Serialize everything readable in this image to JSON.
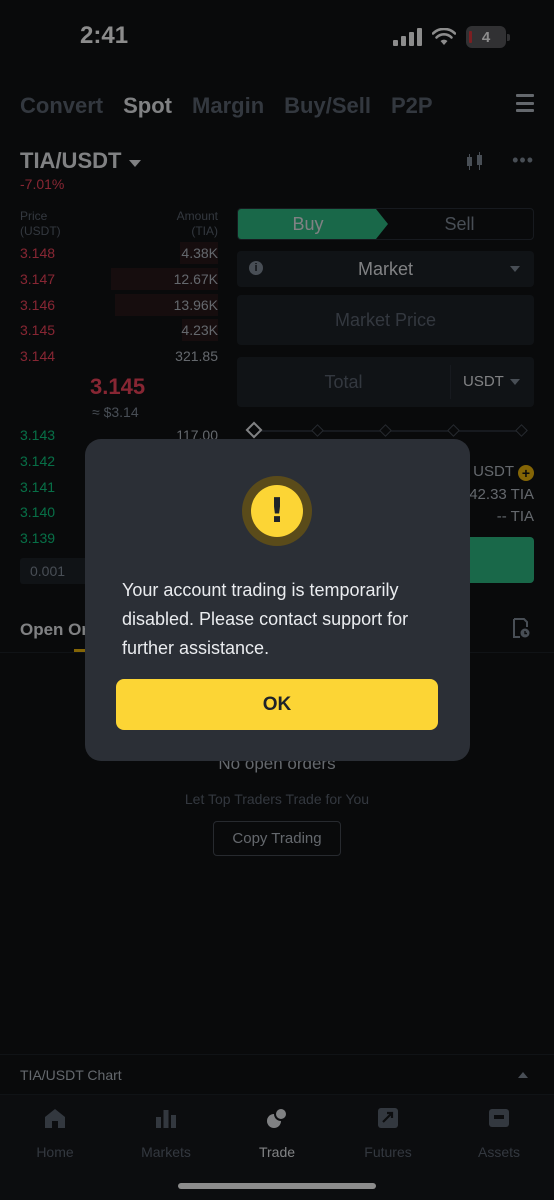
{
  "status": {
    "time": "2:41",
    "battery": "4"
  },
  "top_tabs": [
    {
      "label": "Convert",
      "active": false
    },
    {
      "label": "Spot",
      "active": true
    },
    {
      "label": "Margin",
      "active": false
    },
    {
      "label": "Buy/Sell",
      "active": false
    },
    {
      "label": "P2P",
      "active": false
    }
  ],
  "pair": {
    "name": "TIA/USDT",
    "change": "-7.01%"
  },
  "order_book": {
    "price_label": "Price",
    "price_unit": "(USDT)",
    "amount_label": "Amount",
    "amount_unit": "(TIA)",
    "asks": [
      {
        "price": "3.148",
        "amount": "4.38K",
        "depth": 0.19
      },
      {
        "price": "3.147",
        "amount": "12.67K",
        "depth": 0.54
      },
      {
        "price": "3.146",
        "amount": "13.96K",
        "depth": 0.52
      },
      {
        "price": "3.145",
        "amount": "4.23K",
        "depth": 0.18
      },
      {
        "price": "3.144",
        "amount": "321.85",
        "depth": 0.0
      }
    ],
    "mid_price": "3.145",
    "mid_fiat": "≈ $3.14",
    "bids": [
      {
        "price": "3.143",
        "amount": "117.00"
      },
      {
        "price": "3.142",
        "amount": ""
      },
      {
        "price": "3.141",
        "amount": ""
      },
      {
        "price": "3.140",
        "amount": ""
      },
      {
        "price": "3.139",
        "amount": ""
      }
    ],
    "precision": "0.001"
  },
  "order_form": {
    "buy_label": "Buy",
    "sell_label": "Sell",
    "order_type": "Market",
    "price_placeholder": "Market Price",
    "total_placeholder": "Total",
    "total_currency": "USDT",
    "avail_currency": "USDT",
    "max_buy": "42.33 TIA",
    "est_fee": "-- TIA"
  },
  "orders": {
    "tab_label": "Open Or",
    "empty_title": "No open orders",
    "empty_sub": "Let Top Traders Trade for You",
    "copy_button": "Copy Trading"
  },
  "chart_bar": {
    "label": "TIA/USDT Chart"
  },
  "bottom_nav": [
    {
      "label": "Home",
      "icon": "home-icon",
      "active": false
    },
    {
      "label": "Markets",
      "icon": "markets-icon",
      "active": false
    },
    {
      "label": "Trade",
      "icon": "trade-icon",
      "active": true
    },
    {
      "label": "Futures",
      "icon": "futures-icon",
      "active": false
    },
    {
      "label": "Assets",
      "icon": "assets-icon",
      "active": false
    }
  ],
  "dialog": {
    "message": "Your account trading is temporarily disabled. Please contact support for further assistance.",
    "ok_label": "OK"
  },
  "colors": {
    "accent": "#FCD535",
    "buy": "#2EBD85",
    "sell": "#F6465D",
    "background": "#111315"
  }
}
